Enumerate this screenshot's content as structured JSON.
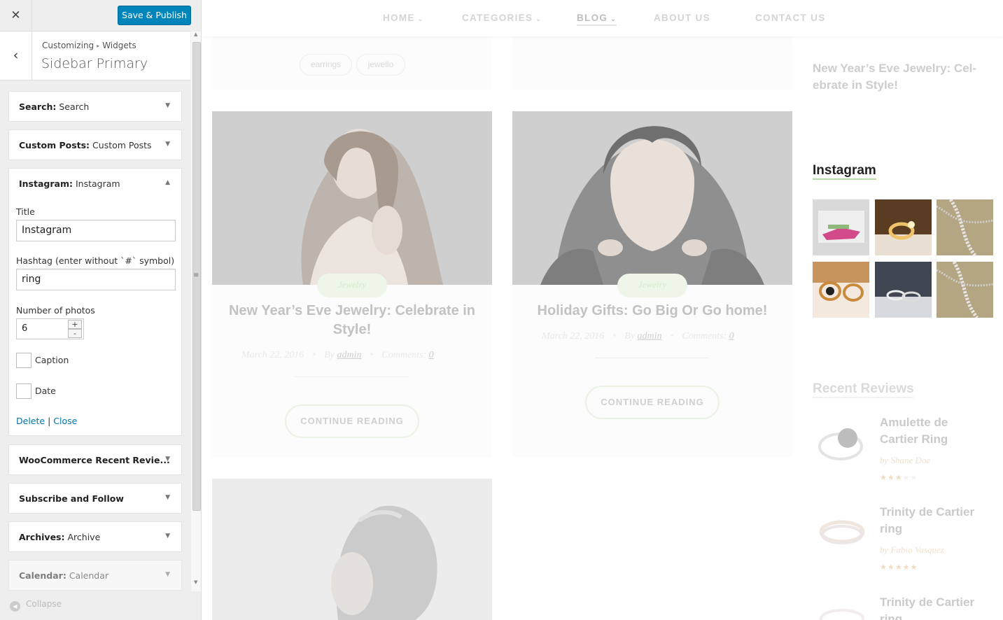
{
  "customizer": {
    "close_icon": "close-icon",
    "publish_label": "Save & Publish",
    "breadcrumb": [
      "Customizing",
      "Widgets"
    ],
    "breadcrumb_sep": "▸",
    "panel_title": "Sidebar Primary",
    "widgets_before": [
      {
        "type": "Search:",
        "name": "Search"
      },
      {
        "type": "Custom Posts:",
        "name": "Custom Posts"
      },
      {
        "type": "Instagram:",
        "name": "Instagram"
      }
    ],
    "form": {
      "title_label": "Title",
      "title_value": "Instagram",
      "hashtag_label": "Hashtag (enter without `#` symbol)",
      "hashtag_value": "ring",
      "photos_label": "Number of photos",
      "photos_value": "6",
      "caption_label": "Caption",
      "caption_checked": false,
      "date_label": "Date",
      "date_checked": false,
      "delete_label": "Delete",
      "link_sep": "|",
      "close_label": "Close"
    },
    "widgets_after": [
      {
        "type": "WooCommerce Recent Revie...",
        "name": ""
      },
      {
        "type": "Subscribe and Follow",
        "name": ""
      },
      {
        "type": "Archives:",
        "name": "Archive"
      },
      {
        "type": "Calendar:",
        "name": "Calendar"
      }
    ],
    "collapse_label": "Collapse"
  },
  "site": {
    "nav": [
      {
        "label": "HOME",
        "dropdown": true
      },
      {
        "label": "CATEGORIES",
        "dropdown": true
      },
      {
        "label": "BLOG",
        "dropdown": true,
        "active": true
      },
      {
        "label": "ABOUT US",
        "dropdown": false
      },
      {
        "label": "CONTACT US",
        "dropdown": false
      }
    ],
    "tags": [
      "earrings",
      "jewello"
    ],
    "posts": [
      {
        "category": "Jewelry",
        "title": "New Year’s Eve Jewelry: Celebrate in Style!",
        "date": "March 22, 2016",
        "by": "By",
        "author": "admin",
        "comments_label": "Comments:",
        "comments": "0",
        "cta": "CONTINUE READING"
      },
      {
        "category": "Jewelry",
        "title": "Holiday Gifts: Go Big Or Go home!",
        "date": "March 22, 2016",
        "by": "By",
        "author": "admin",
        "comments_label": "Comments:",
        "comments": "0",
        "cta": "CONTINUE READING"
      }
    ],
    "sidebar": {
      "custom_post_title": "New Year’s Eve Jewelry: Cel-ebrate in Style!",
      "instagram_title": "Instagram",
      "recent_reviews_title": "Recent Reviews",
      "reviews": [
        {
          "name": "Amulette de Cartier Ring",
          "by": "by",
          "reviewer": "Shane Doe",
          "rating": 3,
          "max": 5
        },
        {
          "name": "Trinity de Cartier ring",
          "by": "by",
          "reviewer": "Fabio Vasquez",
          "rating": 5,
          "max": 5
        },
        {
          "name": "Trinity de Cartier ring",
          "by": "",
          "reviewer": "",
          "rating": 0,
          "max": 5
        }
      ]
    }
  }
}
